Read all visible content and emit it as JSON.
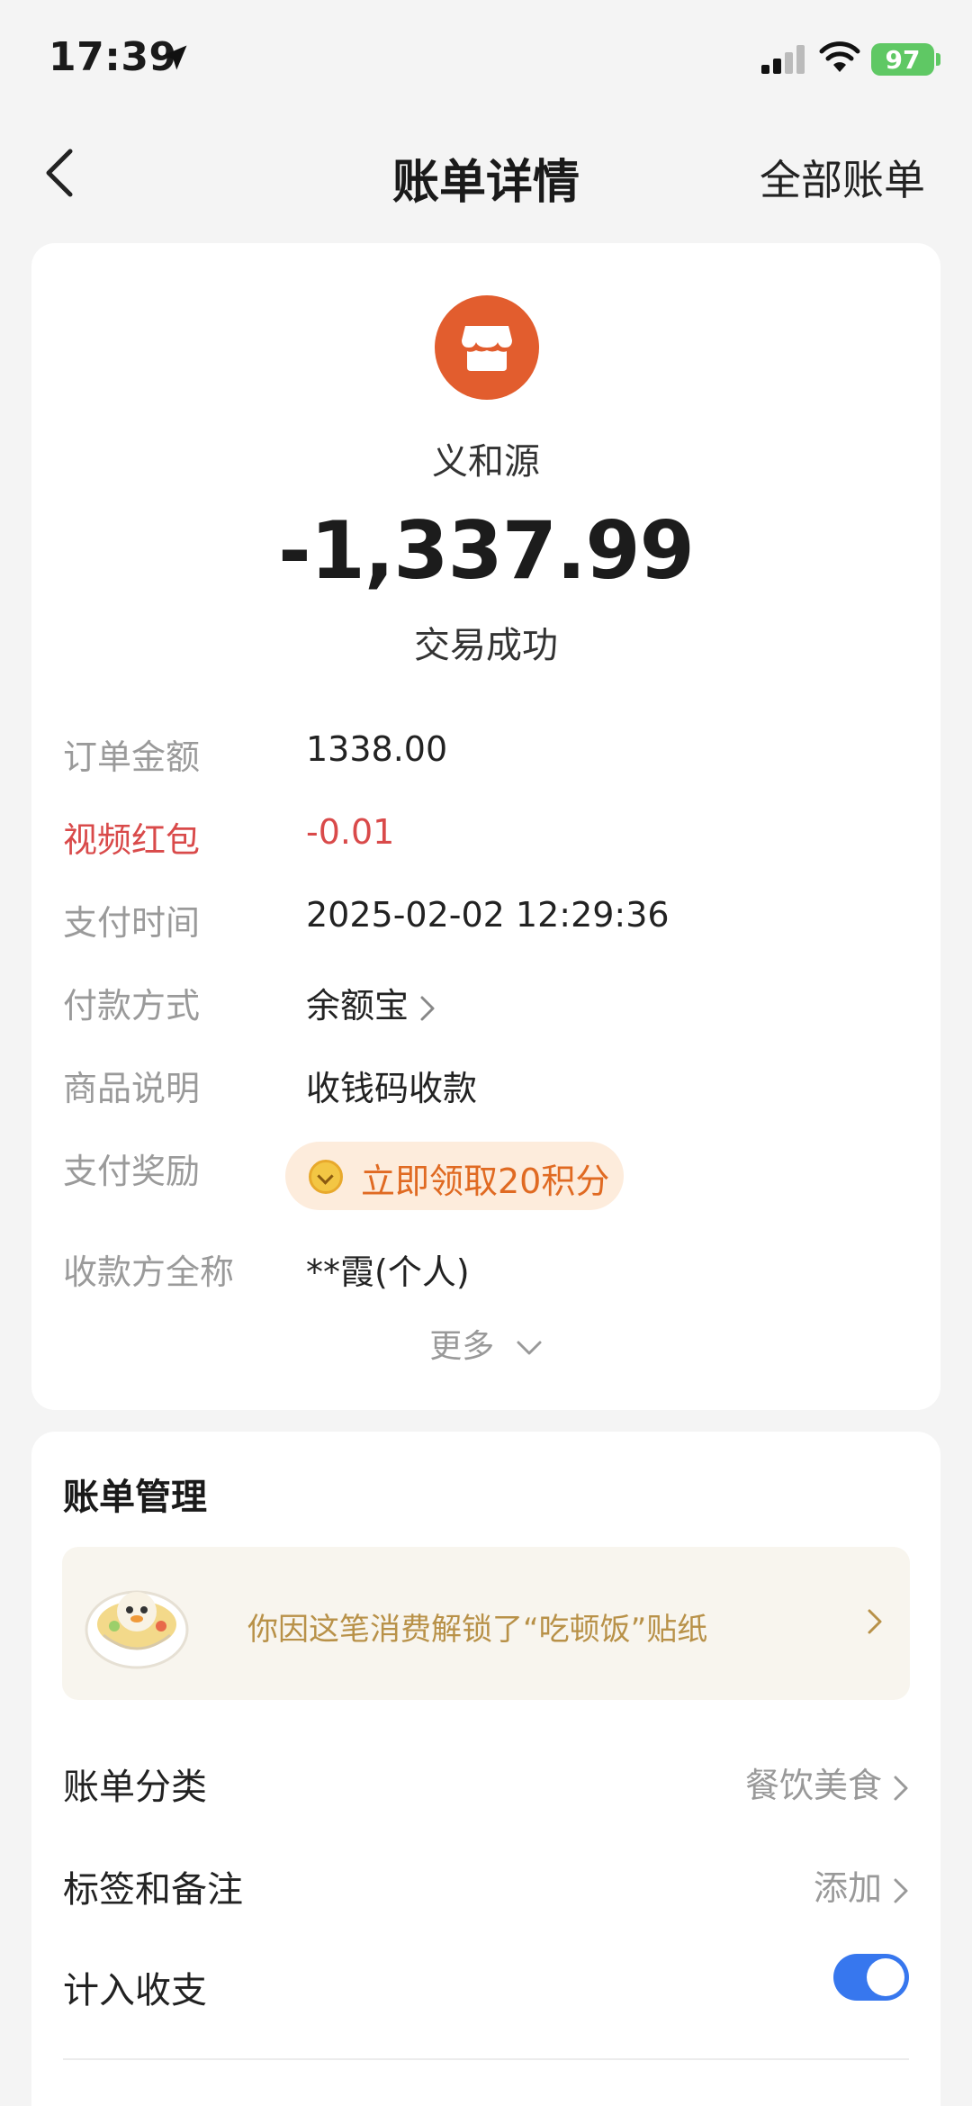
{
  "status_bar": {
    "time": "17:39",
    "battery": "97"
  },
  "nav": {
    "title": "账单详情",
    "right_link": "全部账单"
  },
  "transaction": {
    "merchant": "义和源",
    "amount": "-1,337.99",
    "status": "交易成功"
  },
  "details": {
    "order_amount_label": "订单金额",
    "order_amount": "1338.00",
    "red_packet_label": "视频红包",
    "red_packet": "-0.01",
    "pay_time_label": "支付时间",
    "pay_time": "2025-02-02 12:29:36",
    "pay_method_label": "付款方式",
    "pay_method": "余额宝",
    "goods_label": "商品说明",
    "goods": "收钱码收款",
    "reward_label": "支付奖励",
    "reward": "立即领取20积分",
    "payee_label": "收款方全称",
    "payee": "**霞(个人)",
    "more": "更多"
  },
  "management": {
    "title": "账单管理",
    "sticker_text": "你因这笔消费解锁了“吃顿饭”贴纸",
    "category_label": "账单分类",
    "category_value": "餐饮美食",
    "tags_label": "标签和备注",
    "tags_value": "添加",
    "include_label": "计入收支",
    "include_on": true
  },
  "colors": {
    "accent": "#3777ee",
    "merchant_icon": "#e25d2e",
    "red": "#d94a4a",
    "reward": "#e06a22",
    "sticker_text": "#b89148"
  }
}
